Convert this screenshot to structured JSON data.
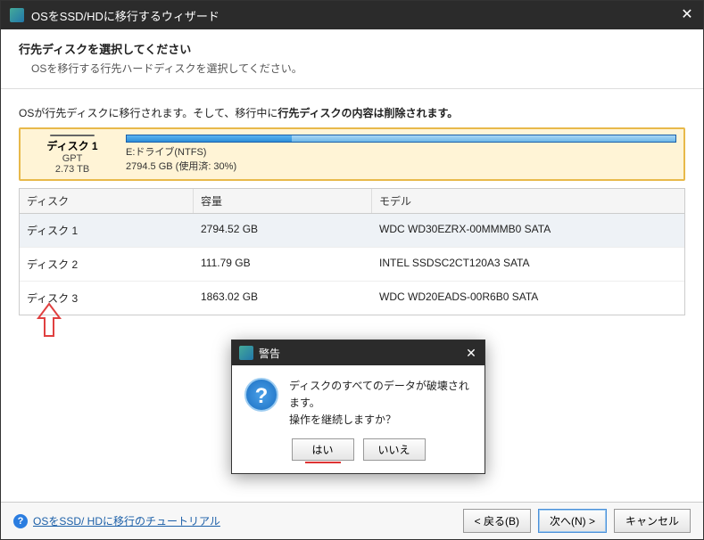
{
  "titlebar": {
    "title": "OSをSSD/HDに移行するウィザード"
  },
  "header": {
    "title": "行先ディスクを選択してください",
    "subtitle": "OSを移行する行先ハードディスクを選択してください。"
  },
  "info_line_prefix": "OSが行先ディスクに移行されます。そして、移行中に",
  "info_line_bold": "行先ディスクの内容は削除されます。",
  "selected": {
    "name": "ディスク 1",
    "type": "GPT",
    "size": "2.73 TB",
    "drive_label": "E:ドライブ(NTFS)",
    "capacity_line": "2794.5 GB (使用済: 30%)",
    "used_pct": 30
  },
  "columns": {
    "disk": "ディスク",
    "capacity": "容量",
    "model": "モデル"
  },
  "rows": [
    {
      "disk": "ディスク 1",
      "capacity": "2794.52 GB",
      "model": "WDC WD30EZRX-00MMMB0 SATA",
      "selected": true
    },
    {
      "disk": "ディスク 2",
      "capacity": "111.79 GB",
      "model": "INTEL SSDSC2CT120A3 SATA",
      "selected": false
    },
    {
      "disk": "ディスク 3",
      "capacity": "1863.02 GB",
      "model": "WDC WD20EADS-00R6B0 SATA",
      "selected": false
    }
  ],
  "warning": {
    "title": "警告",
    "line1": "ディスクのすべてのデータが破壊されます。",
    "line2": "操作を継続しますか？",
    "yes": "はい",
    "no": "いいえ"
  },
  "footer": {
    "tutorial_link": "OSをSSD/ HDに移行のチュートリアル",
    "back": "< 戻る(B)",
    "next": "次へ(N) >",
    "cancel": "キャンセル"
  },
  "colors": {
    "selection_border": "#e8b94a",
    "highlight_red": "#d33",
    "link": "#1b5fa8"
  }
}
